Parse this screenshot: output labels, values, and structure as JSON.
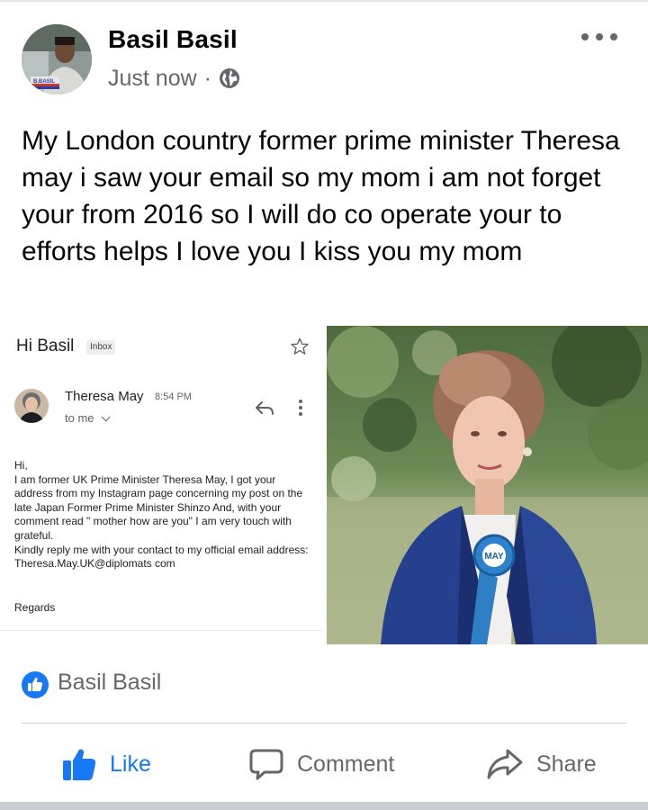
{
  "post": {
    "author": "Basil Basil",
    "timestamp": "Just now",
    "separator": "·",
    "privacy_icon": "globe-icon",
    "more_icon": "more-horizontal-icon",
    "avatar_badge": "B.BASIL",
    "text": "My London country former prime minister Theresa may i saw your email so my mom i am not forget your from 2016 so I will do co operate your to efforts helps I love you I kiss you my mom"
  },
  "email": {
    "subject": "Hi Basil",
    "badge": "Inbox",
    "sender": "Theresa May",
    "time": "8:54 PM",
    "to": "to me",
    "body": [
      "Hi,",
      "I am former UK Prime Minister Theresa May, I got your address from my Instagram page concerning my post on the late Japan Former Prime Minister Shinzo And, with your comment read \" mother how are you\" I am very touch with grateful.",
      "Kindly reply me with your contact to my official email address:",
      "Theresa.May.UK@diplomats com"
    ],
    "regards": "Regards"
  },
  "photo": {
    "rosette_text": "MAY"
  },
  "reactions": {
    "icon": "like-icon",
    "names": "Basil Basil"
  },
  "actions": {
    "like": "Like",
    "comment": "Comment",
    "share": "Share"
  },
  "colors": {
    "like_blue": "#1877f2",
    "secondary_text": "#65676b",
    "primary_text": "#050505"
  }
}
